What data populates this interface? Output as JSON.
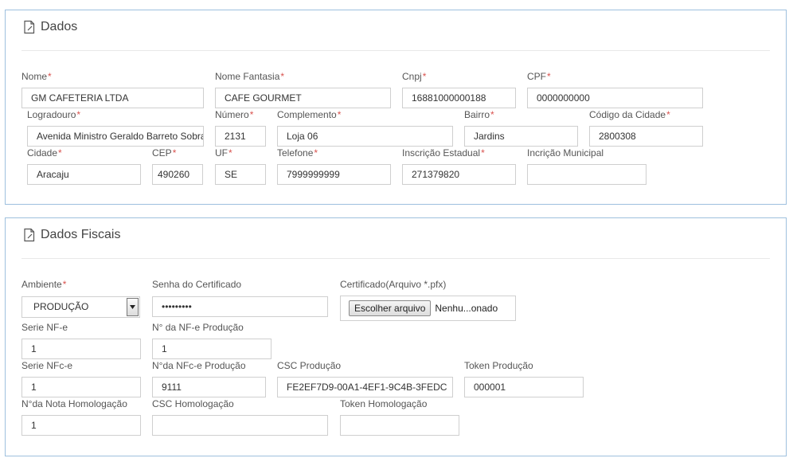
{
  "dados": {
    "title": "Dados",
    "icon": "document-edit-icon",
    "required_mark": "*",
    "labels": {
      "nome": "Nome",
      "nome_fantasia": "Nome Fantasia",
      "cnpj": "Cnpj",
      "cpf": "CPF",
      "logradouro": "Logradouro",
      "numero": "Número",
      "complemento": "Complemento",
      "bairro": "Bairro",
      "codigo_cidade": "Código da Cidade",
      "cidade": "Cidade",
      "cep": "CEP",
      "uf": "UF",
      "telefone": "Telefone",
      "inscricao_estadual": "Inscrição Estadual",
      "inscricao_municipal": "Incrição Municipal"
    },
    "values": {
      "nome": "GM CAFETERIA LTDA",
      "nome_fantasia": "CAFE GOURMET",
      "cnpj": "16881000000188",
      "cpf": "0000000000",
      "logradouro": "Avenida Ministro Geraldo Barreto Sobral",
      "numero": "2131",
      "complemento": "Loja 06",
      "bairro": "Jardins",
      "codigo_cidade": "2800308",
      "cidade": "Aracaju",
      "cep": "490260",
      "uf": "SE",
      "telefone": "7999999999",
      "inscricao_estadual": "271379820",
      "inscricao_municipal": ""
    }
  },
  "fiscais": {
    "title": "Dados Fiscais",
    "icon": "document-edit-icon",
    "labels": {
      "ambiente": "Ambiente",
      "senha_certificado": "Senha do Certificado",
      "certificado": "Certificado(Arquivo *.pfx)",
      "serie_nfe": "Serie NF-e",
      "n_nfe_producao": "N° da NF-e Produção",
      "serie_nfce": "Serie NFc-e",
      "n_nfce_producao": "N°da NFc-e Produção",
      "csc_producao": "CSC Produção",
      "token_producao": "Token Produção",
      "n_nota_homologacao": "N°da Nota Homologação",
      "csc_homologacao": "CSC Homologação",
      "token_homologacao": "Token Homologação"
    },
    "values": {
      "ambiente": "PRODUÇÃO",
      "senha_certificado": "•••••••••",
      "file_button": "Escolher arquivo",
      "file_status": "Nenhu...onado",
      "serie_nfe": "1",
      "n_nfe_producao": "1",
      "serie_nfce": "1",
      "n_nfce_producao": "9111",
      "csc_producao": "FE2EF7D9-00A1-4EF1-9C4B-3FEDC",
      "token_producao": "000001",
      "n_nota_homologacao": "1",
      "csc_homologacao": "",
      "token_homologacao": ""
    }
  },
  "colors": {
    "panel_border": "#9ec0de",
    "required": "#d9534f",
    "input_border": "#cfcfcf"
  }
}
